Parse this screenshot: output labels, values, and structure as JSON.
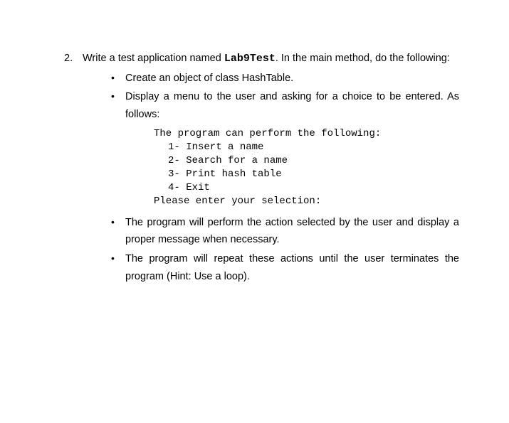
{
  "item": {
    "number": "2.",
    "intro_part1": "Write a test application named ",
    "app_name": "Lab9Test",
    "intro_part2": ". In the main method, do the following:"
  },
  "bullets": [
    "Create an object of class HashTable.",
    "Display a menu to the user and asking for a choice to be entered. As follows:",
    "The program will perform the action selected by the user and display a proper message when necessary.",
    "The program will repeat these actions until the user terminates the program (Hint: Use a loop)."
  ],
  "code": {
    "line1": "The program can perform the following:",
    "line2": "1- Insert a name",
    "line3": "2- Search for a name",
    "line4": "3- Print hash table",
    "line5": "4- Exit",
    "line6": "Please enter your selection:"
  }
}
